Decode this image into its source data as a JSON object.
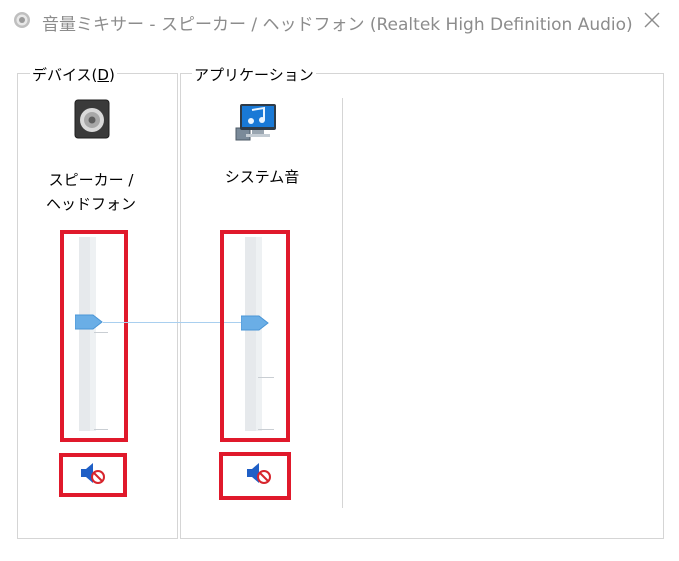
{
  "window": {
    "title": "音量ミキサー - スピーカー / ヘッドフォン (Realtek High Definition Audio)"
  },
  "devices": {
    "label_prefix": "デバイス(",
    "label_accel": "D",
    "label_suffix": ")",
    "device": {
      "name_line1": "スピーカー /",
      "name_line2": "ヘッドフォン",
      "icon": "speaker-icon",
      "volume_percent": 50,
      "muted": true
    }
  },
  "applications": {
    "label": "アプリケーション",
    "apps": [
      {
        "name": "システム音",
        "icon": "system-sounds-icon",
        "volume_percent": 50,
        "muted": true
      }
    ]
  },
  "colors": {
    "highlight_border": "#e0192b",
    "slider_thumb": "#6aaee6",
    "mute_speaker": "#1f5fc6",
    "mute_badge": "#d7252d"
  }
}
